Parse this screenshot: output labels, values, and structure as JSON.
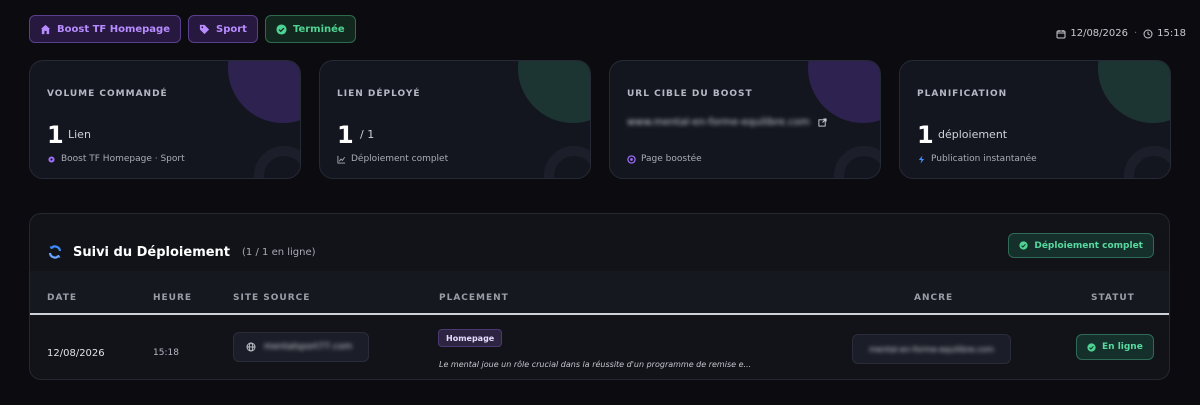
{
  "tags": [
    {
      "label": "Boost TF Homepage",
      "icon": "home-icon"
    },
    {
      "label": "Sport",
      "icon": "tag-icon"
    },
    {
      "label": "Terminée",
      "icon": "check-circle-icon"
    }
  ],
  "header": {
    "date": "12/08/2026",
    "separator": "·",
    "time": "15:18"
  },
  "cards": {
    "volume": {
      "label": "VOLUME COMMANDÉ",
      "value": "1",
      "unit": "Lien",
      "sub": "Boost TF Homepage · Sport"
    },
    "link": {
      "label": "LIEN DÉPLOYÉ",
      "value": "1",
      "unit": "/ 1",
      "sub": "Déploiement complet"
    },
    "url": {
      "label": "URL CIBLE DU BOOST",
      "url": "www.mental-en-forme-equilibre.com",
      "sub": "Page boostée"
    },
    "plan": {
      "label": "PLANIFICATION",
      "value": "1",
      "unit": "déploiement",
      "sub": "Publication instantanée"
    }
  },
  "panel": {
    "title": "Suivi du Déploiement",
    "count": "(1 / 1 en ligne)",
    "badge": "Déploiement complet",
    "columns": {
      "date": "DATE",
      "heure": "HEURE",
      "site": "SITE SOURCE",
      "placement": "PLACEMENT",
      "ancre": "ANCRE",
      "statut": "STATUT"
    },
    "row": {
      "date": "12/08/2026",
      "heure": "15:18",
      "site": "mentalsport77.com",
      "placement_tag": "Homepage",
      "placement_text": "Le mental joue un rôle crucial dans la réussite d'un programme de remise e...",
      "ancre": "mental-en-forme-equilibre.com",
      "statut": "En ligne"
    }
  },
  "colors": {
    "accent_purple": "#8a5cf6",
    "accent_green": "#4fd393",
    "background": "#0c0c10"
  }
}
